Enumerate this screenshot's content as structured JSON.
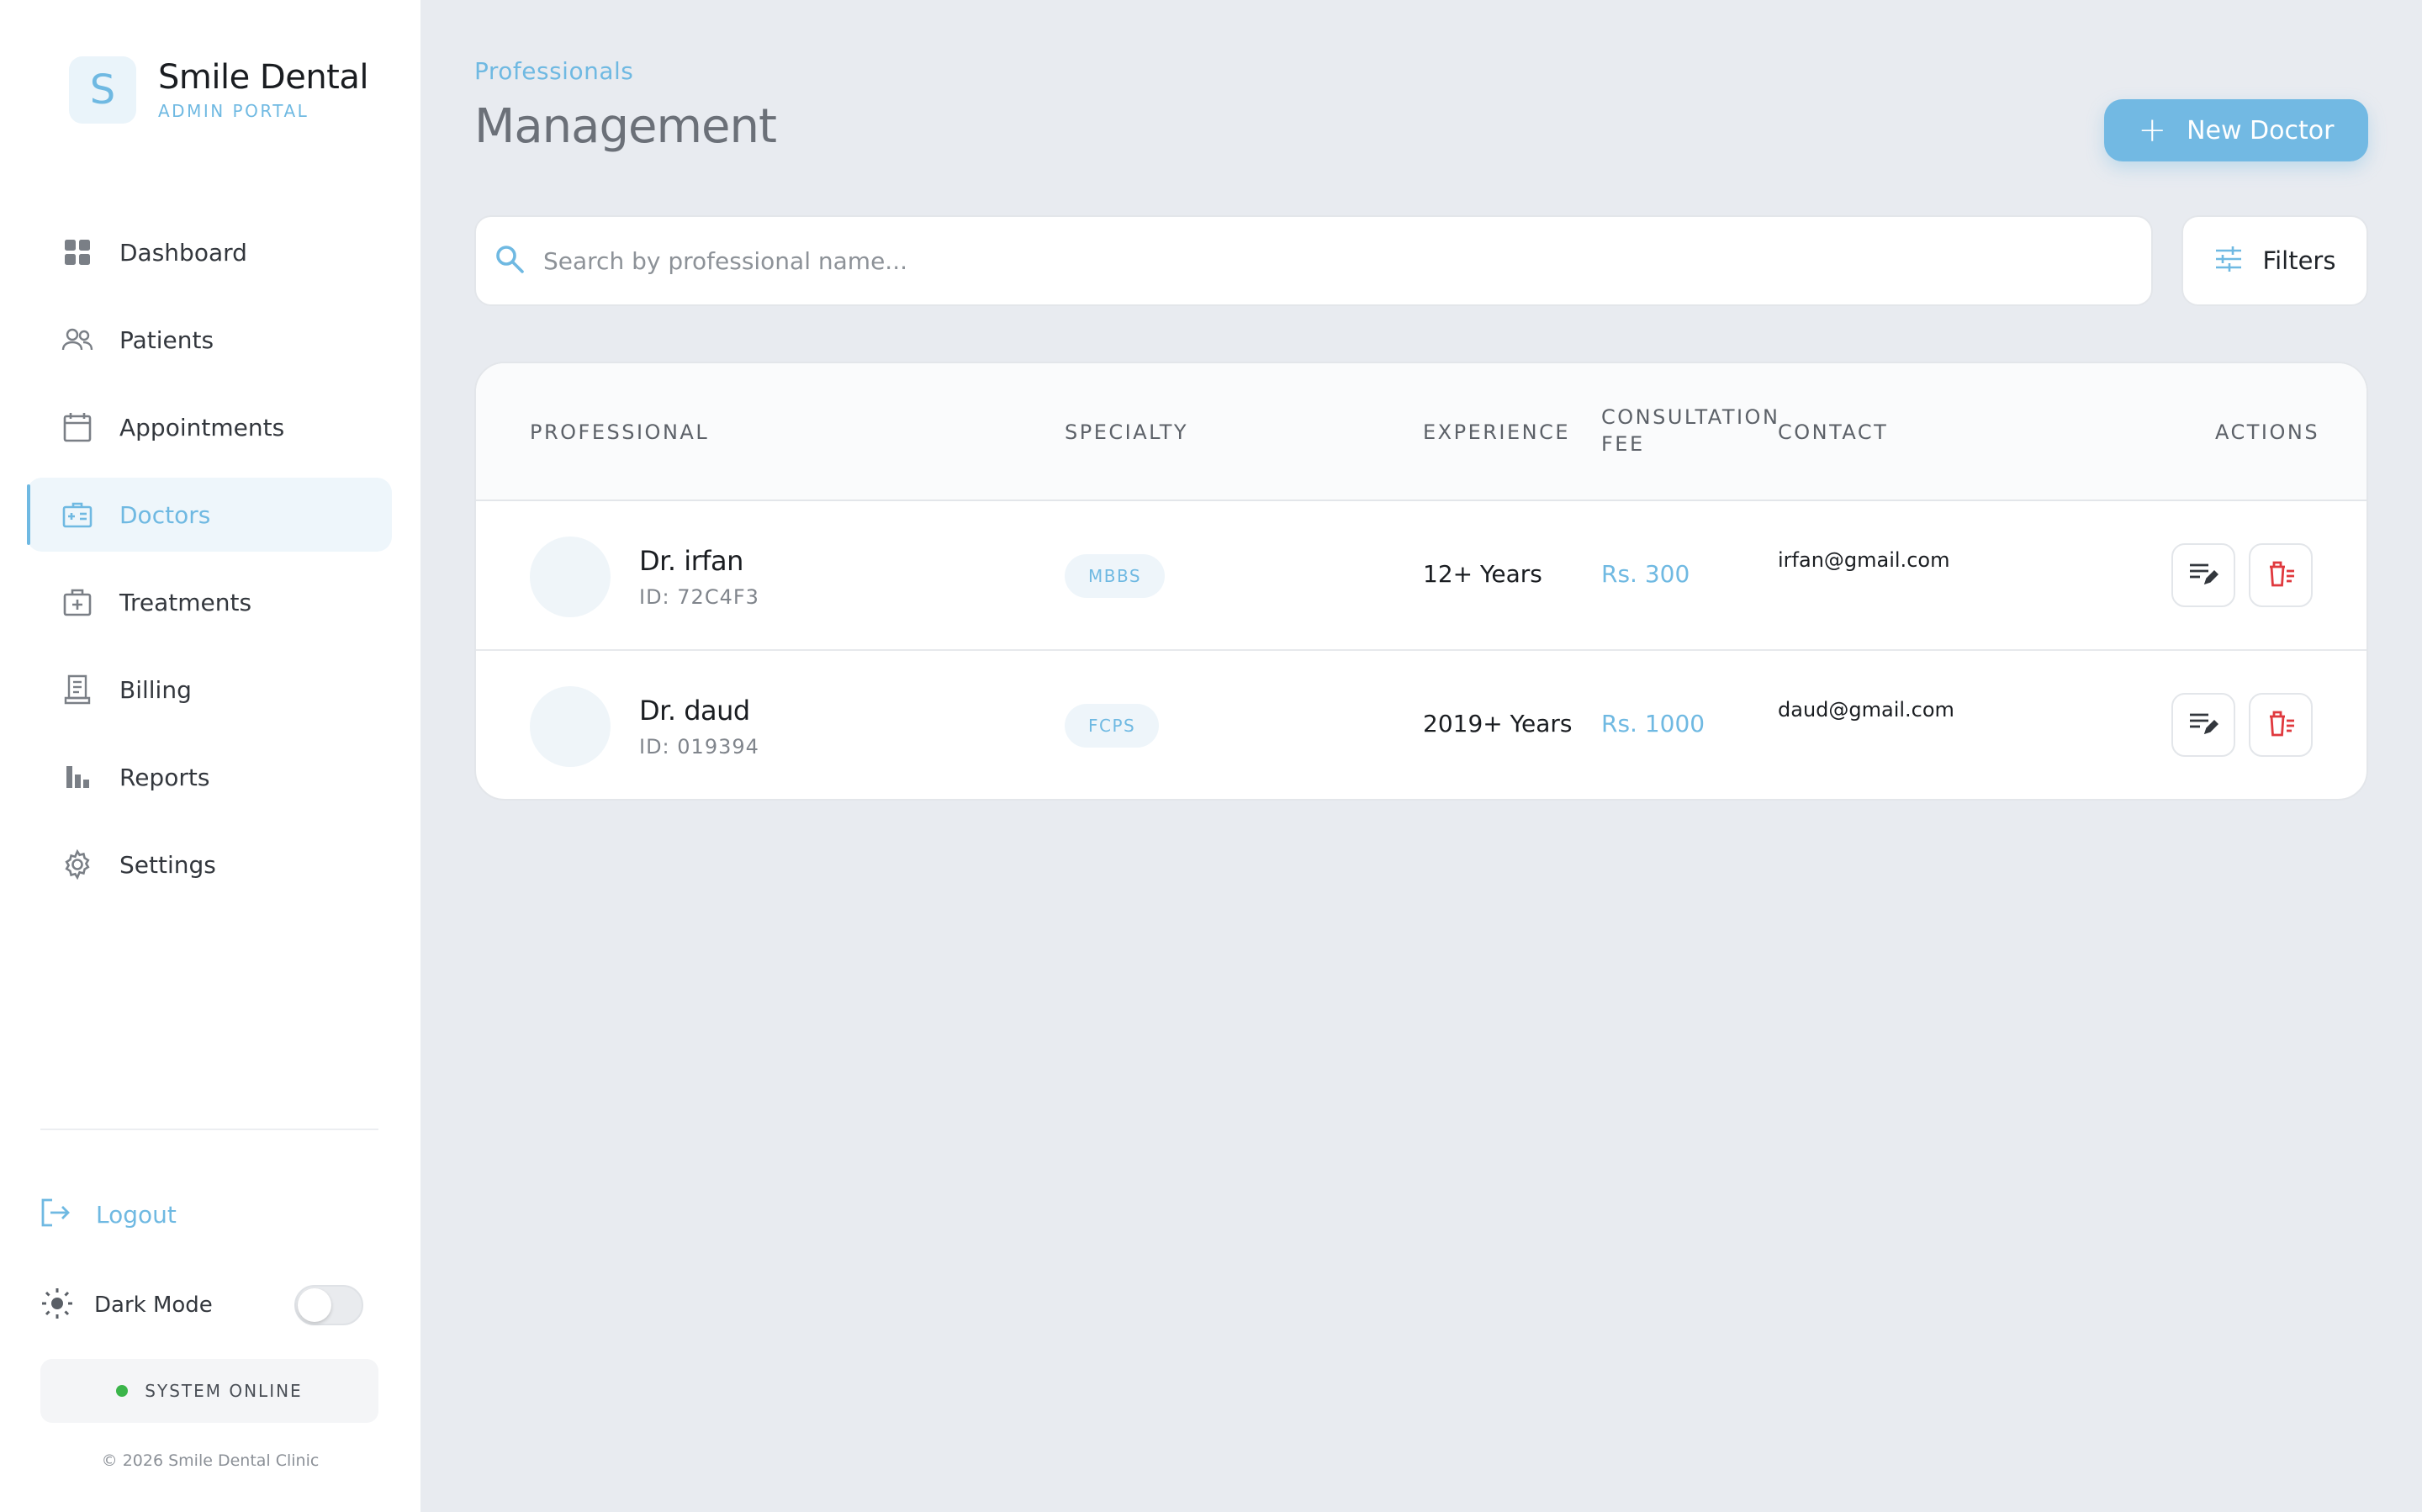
{
  "brand": {
    "logo_letter": "S",
    "name": "Smile Dental",
    "subtitle": "ADMIN PORTAL"
  },
  "sidebar": {
    "items": [
      {
        "label": "Dashboard",
        "icon": "grid-icon",
        "active": false
      },
      {
        "label": "Patients",
        "icon": "users-icon",
        "active": false
      },
      {
        "label": "Appointments",
        "icon": "calendar-icon",
        "active": false
      },
      {
        "label": "Doctors",
        "icon": "medical-id-icon",
        "active": true
      },
      {
        "label": "Treatments",
        "icon": "medical-kit-icon",
        "active": false
      },
      {
        "label": "Billing",
        "icon": "receipt-icon",
        "active": false
      },
      {
        "label": "Reports",
        "icon": "bar-chart-icon",
        "active": false
      },
      {
        "label": "Settings",
        "icon": "gear-icon",
        "active": false
      }
    ],
    "logout_label": "Logout",
    "dark_mode_label": "Dark Mode",
    "dark_mode_on": false,
    "status_label": "SYSTEM ONLINE",
    "copyright": "© 2026 Smile Dental Clinic"
  },
  "header": {
    "breadcrumb": "Professionals",
    "title": "Management",
    "new_button_label": "New Doctor"
  },
  "search": {
    "placeholder": "Search by professional name...",
    "value": ""
  },
  "filters_label": "Filters",
  "table": {
    "columns": {
      "professional": "PROFESSIONAL",
      "specialty": "SPECIALTY",
      "experience": "EXPERIENCE",
      "fee_line1": "CONSULTATION",
      "fee_line2": "FEE",
      "contact": "CONTACT",
      "actions": "ACTIONS"
    },
    "rows": [
      {
        "name": "Dr. irfan",
        "id": "ID: 72C4F3",
        "specialty": "MBBS",
        "experience": "12+ Years",
        "fee": "Rs. 300",
        "email": "irfan@gmail.com"
      },
      {
        "name": "Dr. daud",
        "id": "ID: 019394",
        "specialty": "FCPS",
        "experience": "2019+ Years",
        "fee": "Rs. 1000",
        "email": "daud@gmail.com"
      }
    ]
  },
  "colors": {
    "accent": "#6fb9e2",
    "danger": "#e0393e",
    "online": "#3bb54a",
    "background": "#e8ebf0"
  }
}
